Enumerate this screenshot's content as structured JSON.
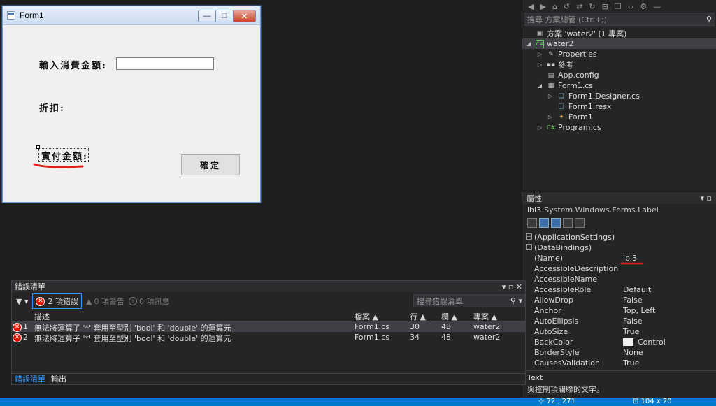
{
  "form": {
    "title": "Form1",
    "win_min": "—",
    "win_max": "□",
    "win_close": "✕",
    "label1": "輸入消費金額:",
    "label2": "折扣:",
    "label3": "實付金額:",
    "button": "確定"
  },
  "solution": {
    "search_placeholder": "搜尋 方案總管 (Ctrl+;)",
    "items": [
      {
        "label": "方案 'water2' (1 專案)",
        "icon": "solution-icon"
      },
      {
        "label": "water2",
        "icon": "csharp-project-icon"
      },
      {
        "label": "Properties",
        "icon": "wrench-icon"
      },
      {
        "label": "參考",
        "icon": "references-icon"
      },
      {
        "label": "App.config",
        "icon": "config-file-icon"
      },
      {
        "label": "Form1.cs",
        "icon": "form-icon"
      },
      {
        "label": "Form1.Designer.cs",
        "icon": "csharp-file-icon"
      },
      {
        "label": "Form1.resx",
        "icon": "resx-file-icon"
      },
      {
        "label": "Form1",
        "icon": "class-icon"
      },
      {
        "label": "Program.cs",
        "icon": "csharp-file-icon"
      }
    ]
  },
  "properties": {
    "title": "屬性",
    "object_name": "lbl3",
    "object_type": "System.Windows.Forms.Label",
    "rows": [
      {
        "name": "(ApplicationSettings)",
        "value": ""
      },
      {
        "name": "(DataBindings)",
        "value": ""
      },
      {
        "name": "(Name)",
        "value": "lbl3"
      },
      {
        "name": "AccessibleDescription",
        "value": ""
      },
      {
        "name": "AccessibleName",
        "value": ""
      },
      {
        "name": "AccessibleRole",
        "value": "Default"
      },
      {
        "name": "AllowDrop",
        "value": "False"
      },
      {
        "name": "Anchor",
        "value": "Top, Left"
      },
      {
        "name": "AutoEllipsis",
        "value": "False"
      },
      {
        "name": "AutoSize",
        "value": "True"
      },
      {
        "name": "BackColor",
        "value": "Control"
      },
      {
        "name": "BorderStyle",
        "value": "None"
      },
      {
        "name": "CausesValidation",
        "value": "True"
      }
    ],
    "desc_title": "Text",
    "desc_text": "與控制項關聯的文字。"
  },
  "error_list": {
    "title": "錯誤清單",
    "errors_btn": "2 項錯誤",
    "warnings_btn": "0 項警告",
    "messages_btn": "0 項訊息",
    "search_placeholder": "搜尋錯誤清單",
    "columns": {
      "desc": "描述",
      "file": "檔案",
      "line": "行",
      "col": "欄",
      "project": "專案"
    },
    "rows": [
      {
        "num": "1",
        "desc": "無法將運算子 '*' 套用至型別 'bool' 和 'double' 的運算元",
        "file": "Form1.cs",
        "line": "30",
        "col": "48",
        "project": "water2"
      },
      {
        "num": "2",
        "desc": "無法將運算子 '*' 套用至型別 'bool' 和 'double' 的運算元",
        "file": "Form1.cs",
        "line": "34",
        "col": "48",
        "project": "water2"
      }
    ],
    "tabs": [
      "錯誤清單",
      "輸出"
    ]
  },
  "status": {
    "position": "72 , 271",
    "size": "104 x 20"
  },
  "colors": {
    "accent": "#007acc",
    "error": "#e51400",
    "annotation": "#e0201a"
  }
}
